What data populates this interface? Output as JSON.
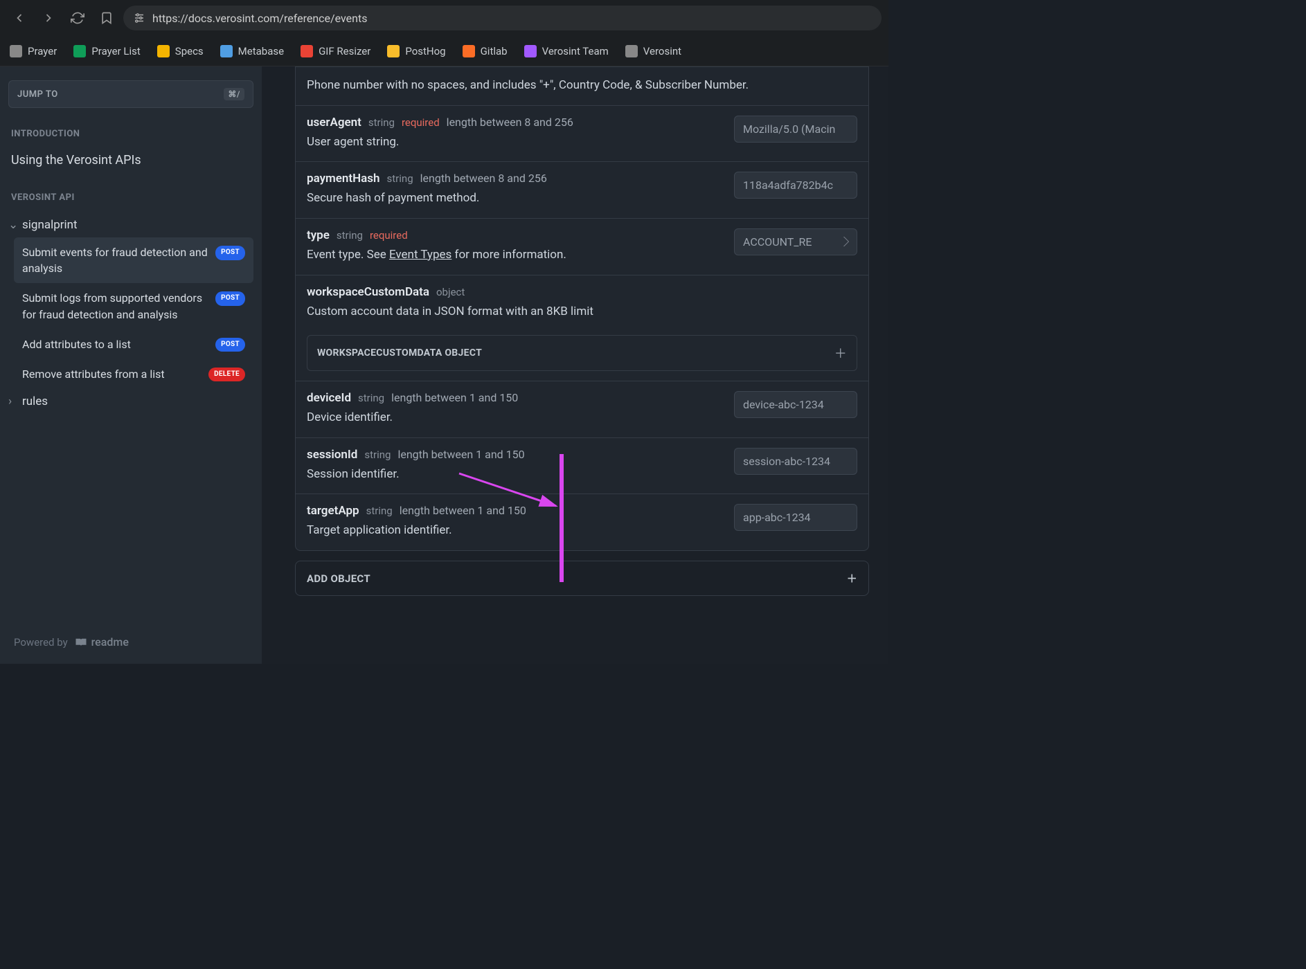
{
  "url": "https://docs.verosint.com/reference/events",
  "bookmarks": [
    {
      "label": "Prayer",
      "color": "#888"
    },
    {
      "label": "Prayer List",
      "color": "#0f9d58"
    },
    {
      "label": "Specs",
      "color": "#f4b400"
    },
    {
      "label": "Metabase",
      "color": "#509ee3"
    },
    {
      "label": "GIF Resizer",
      "color": "#ea4335"
    },
    {
      "label": "PostHog",
      "color": "#f9bd2b"
    },
    {
      "label": "Gitlab",
      "color": "#fc6d26"
    },
    {
      "label": "Verosint Team",
      "color": "#a259ff"
    },
    {
      "label": "Verosint",
      "color": "#888"
    }
  ],
  "sidebar": {
    "jump_to": "JUMP TO",
    "jump_kbd": "⌘/",
    "sections": {
      "intro_label": "INTRODUCTION",
      "intro_link": "Using the Verosint APIs",
      "api_label": "VEROSINT API",
      "groups": [
        {
          "name": "signalprint",
          "expanded": true,
          "items": [
            {
              "label": "Submit events for fraud detection and analysis",
              "method": "POST",
              "active": true
            },
            {
              "label": "Submit logs from supported vendors for fraud detection and analysis",
              "method": "POST"
            },
            {
              "label": "Add attributes to a list",
              "method": "POST"
            },
            {
              "label": "Remove attributes from a list",
              "method": "DELETE"
            }
          ]
        },
        {
          "name": "rules",
          "expanded": false,
          "items": []
        }
      ]
    },
    "powered_by": "Powered by",
    "readme": "readme"
  },
  "params": [
    {
      "name": "",
      "type": "",
      "required": false,
      "constraint": "",
      "desc": "Phone number with no spaces, and includes \"+\", Country Code, & Subscriber Number.",
      "input": null,
      "noHeader": true
    },
    {
      "name": "userAgent",
      "type": "string",
      "required": true,
      "constraint": "length between 8 and 256",
      "desc": "User agent string.",
      "input": "Mozilla/5.0 (Macin"
    },
    {
      "name": "paymentHash",
      "type": "string",
      "required": false,
      "constraint": "length between 8 and 256",
      "desc": "Secure hash of payment method.",
      "input": "118a4adfa782b4c"
    },
    {
      "name": "type",
      "type": "string",
      "required": true,
      "constraint": "",
      "desc": "Event type. See <a href='#'>Event Types</a> for more information.",
      "select": "ACCOUNT_RE"
    },
    {
      "name": "workspaceCustomData",
      "type": "object",
      "required": false,
      "constraint": "",
      "desc": "Custom account data in JSON format with an 8KB limit",
      "expand": "WORKSPACECUSTOMDATA OBJECT"
    },
    {
      "name": "deviceId",
      "type": "string",
      "required": false,
      "constraint": "length between 1 and 150",
      "desc": "Device identifier.",
      "input": "device-abc-1234"
    },
    {
      "name": "sessionId",
      "type": "string",
      "required": false,
      "constraint": "length between 1 and 150",
      "desc": "Session identifier.",
      "input": "session-abc-1234"
    },
    {
      "name": "targetApp",
      "type": "string",
      "required": false,
      "constraint": "length between 1 and 150",
      "desc": "Target application identifier.",
      "input": "app-abc-1234"
    }
  ],
  "add_object": "ADD OBJECT"
}
